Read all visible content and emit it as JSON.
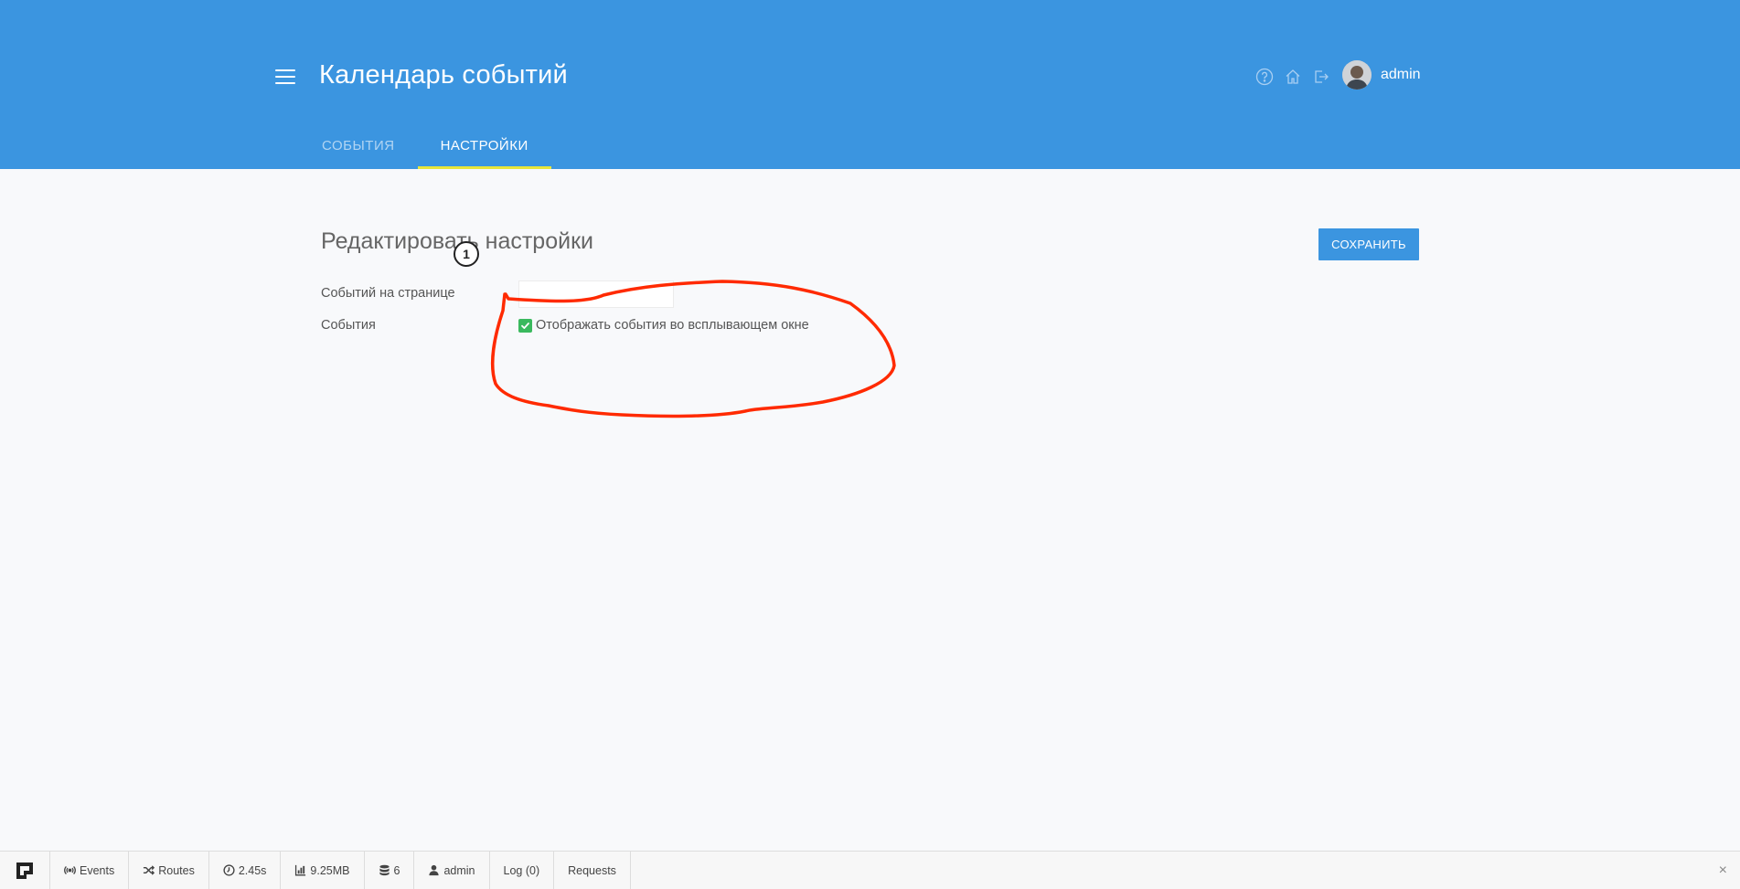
{
  "header": {
    "title": "Календарь событий",
    "user": {
      "name": "admin"
    },
    "icons": [
      "help-icon",
      "home-icon",
      "logout-icon"
    ],
    "tabs": [
      {
        "label": "СОБЫТИЯ",
        "active": false
      },
      {
        "label": "НАСТРОЙКИ",
        "active": true
      }
    ]
  },
  "content": {
    "section_title": "Редактировать настройки",
    "save_label": "СОХРАНИТЬ",
    "fields": {
      "per_page_label": "Событий на странице",
      "per_page_value": "",
      "events_label": "События",
      "popup_checkbox_label": "Отображать события во всплывающем окне",
      "popup_checked": true
    }
  },
  "annotation": {
    "step_number": "1",
    "color": "#ff2a00"
  },
  "debugbar": {
    "items": [
      {
        "label": "Events",
        "icon": "broadcast-icon"
      },
      {
        "label": "Routes",
        "icon": "shuffle-icon"
      },
      {
        "label": "2.45s",
        "icon": "clock-icon"
      },
      {
        "label": "9.25MB",
        "icon": "bar-chart-icon"
      },
      {
        "label": "6",
        "icon": "database-icon"
      },
      {
        "label": "admin",
        "icon": "user-icon"
      },
      {
        "label": "Log (0)",
        "icon": ""
      },
      {
        "label": "Requests",
        "icon": ""
      }
    ],
    "close": "×"
  },
  "colors": {
    "brand": "#3b95e0",
    "tab_indicator": "#e8e63a",
    "checkbox": "#3ab95e"
  }
}
